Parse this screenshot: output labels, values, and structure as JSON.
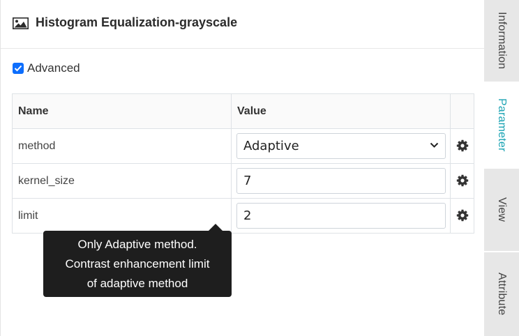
{
  "header": {
    "title": "Histogram Equalization-grayscale",
    "icon": "image-icon"
  },
  "advanced": {
    "label": "Advanced",
    "checked": true
  },
  "table": {
    "headers": {
      "name": "Name",
      "value": "Value"
    },
    "rows": [
      {
        "name": "method",
        "value": "Adaptive",
        "control": "select"
      },
      {
        "name": "kernel_size",
        "value": "7",
        "control": "input"
      },
      {
        "name": "limit",
        "value": "2",
        "control": "input"
      }
    ]
  },
  "tooltip": {
    "lines": [
      "Only Adaptive method.",
      "Contrast enhancement limit",
      "of adaptive method"
    ]
  },
  "tabs": [
    {
      "label": "Information",
      "active": false
    },
    {
      "label": "Parameter",
      "active": true
    },
    {
      "label": "View",
      "active": false
    },
    {
      "label": "Attribute",
      "active": false
    }
  ],
  "colors": {
    "accent": "#1aa3b3",
    "checkbox": "#0d6efd",
    "tooltip_bg": "#1e1e1e",
    "tab_bg": "#e7e7e7"
  }
}
